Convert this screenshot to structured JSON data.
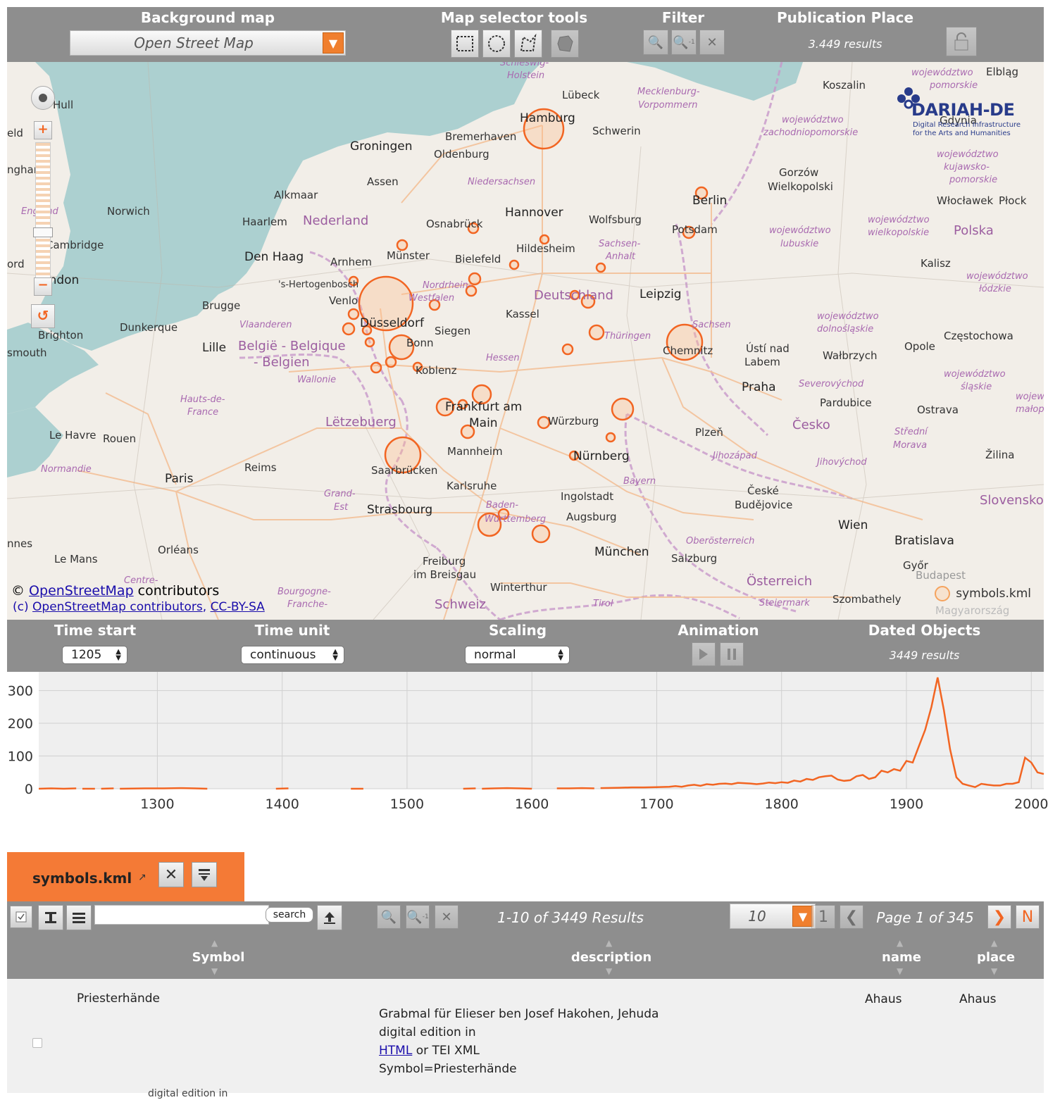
{
  "toolbar": {
    "background_map_title": "Background map",
    "background_map_value": "Open Street Map",
    "map_selector_title": "Map selector tools",
    "filter_title": "Filter",
    "publication_place_title": "Publication Place",
    "publication_place_results": "3.449 results",
    "icons": [
      "square-select-icon",
      "circle-select-icon",
      "polygon-select-icon",
      "country-select-icon",
      "zoom-in-icon",
      "zoom-inverse-icon",
      "clear-filter-icon",
      "lock-icon"
    ]
  },
  "map": {
    "attribution_prefix": "©",
    "attribution_link": "OpenStreetMap",
    "attribution_suffix": "contributors",
    "attribution2_prefix": "(c)",
    "attribution2_link1": "OpenStreetMap contributors",
    "attribution2_sep": ",",
    "attribution2_link2": "CC-BY-SA",
    "legend_label": "symbols.kml",
    "logo_title": "DARIAH-DE",
    "logo_sub1": "Digital Research Infrastructure",
    "logo_sub2": "for the Arts and Humanities",
    "marker_color": "#f26522",
    "labels": {
      "hamburg": "Hamburg",
      "lubeck": "Lübeck",
      "schwerin": "Schwerin",
      "bremerhaven": "Bremerhaven",
      "groningen": "Groningen",
      "oldenburg": "Oldenburg",
      "assen": "Assen",
      "alkmaar": "Alkmaar",
      "norwich": "Norwich",
      "haarlem": "Haarlem",
      "nederland": "Nederland",
      "osnabruck": "Osnabrück",
      "hannover": "Hannover",
      "wolfsburg": "Wolfsburg",
      "berlin": "Berlin",
      "potsdam": "Potsdam",
      "denhaag": "Den Haag",
      "arnhem": "Arnhem",
      "munster": "Münster",
      "bielefeld": "Bielefeld",
      "hildesheim": "Hildesheim",
      "london": "London",
      "cambridge": "Cambridge",
      "hull": "Hull",
      "hertogenbosch": "'s-Hertogenbosch",
      "venlo": "Venlo",
      "dusseldorf": "Düsseldorf",
      "kassel": "Kassel",
      "deutschland": "Deutschland",
      "leipzig": "Leipzig",
      "brugge": "Brugge",
      "dunkerque": "Dunkerque",
      "brighton": "Brighton",
      "lille": "Lille",
      "belgie": "België - Belgique",
      "belgien": "- Belgien",
      "bonn": "Bonn",
      "siegen": "Siegen",
      "koblenz": "Koblenz",
      "chemnitz": "Chemnitz",
      "usti": "Ústí nad",
      "labem": "Labem",
      "walbrzych": "Wałbrzych",
      "opole": "Opole",
      "praha": "Praha",
      "pardubice": "Pardubice",
      "frankfurt": "Frankfurt am",
      "main": "Main",
      "wurzburg": "Würzburg",
      "letzebuerg": "Lëtzebuerg",
      "plzen": "Plzeň",
      "cesko": "Česko",
      "ostrava": "Ostrava",
      "mannheim": "Mannheim",
      "nurnberg": "Nürnberg",
      "saarbrucken": "Saarbrücken",
      "reims": "Reims",
      "paris": "Paris",
      "lehavre": "Le Havre",
      "rouen": "Rouen",
      "karlsruhe": "Karlsruhe",
      "strasbourg": "Strasbourg",
      "stuttgart": "Württemberg",
      "ingolstadt": "Ingolstadt",
      "augsburg": "Augsburg",
      "ceske": "České",
      "budejovice": "Budějovice",
      "wien": "Wien",
      "bratislava": "Bratislava",
      "munchen": "München",
      "orleans": "Orléans",
      "lemans": "Le Mans",
      "freiburg": "Freiburg",
      "breisgau": "im Breisgau",
      "winterthur": "Winterthur",
      "salzburg": "Salzburg",
      "osterreich": "Österreich",
      "szombathely": "Szombathely",
      "gyor": "Győr",
      "budapest": "Budapest",
      "koszalin": "Koszalin",
      "elblag": "Elbląg",
      "gorzow": "Gorzów",
      "wielkopolski": "Wielkopolski",
      "wloclawek": "Włocławek",
      "plock": "Płock",
      "polska": "Polska",
      "kalisz": "Kalisz",
      "czestochowa": "Częstochowa",
      "zilina": "Žilina",
      "slovensko": "Slovensko",
      "schweiz": "Schweiz",
      "magyar": "Magyarország",
      "niedersachsen": "Niedersachsen",
      "nordrhein": "Nordrhein-",
      "westfalen": "Westfalen",
      "hessen": "Hessen",
      "thuringen": "Thüringen",
      "sachsen": "Sachsen",
      "sachsenanhalt": "Sachsen-",
      "anhalt": "Anhalt",
      "bayern": "Bayern",
      "baden": "Baden-",
      "mecklenburg": "Mecklenburg-",
      "vorpommern": "Vorpommern",
      "schleswig": "Schleswig-",
      "holstein": "Holstein",
      "vlaanderen": "Vlaanderen",
      "wallonie": "Wallonie",
      "hautsde": "Hauts-de-",
      "france": "France",
      "normandie": "Normandie",
      "grand": "Grand-",
      "est": "Est",
      "centre": "Centre-",
      "bourgogne": "Bourgogne-",
      "franche": "Franche-",
      "tirol": "Tirol",
      "steiermark": "Steiermark",
      "oberosterreich": "Oberösterreich",
      "jihozapad": "Jihozápad",
      "jihovychod": "Jihovýchod",
      "severovychod": "Severovýchod",
      "strednimorava": "Střední",
      "morava": "Morava",
      "zachodnio": "województwo",
      "zachodnio2": "zachodniopomorskie",
      "lubuskie1": "województwo",
      "lubuskie2": "lubuskie",
      "wielkopolskie1": "województwo",
      "wielkopolskie2": "wielkopolskie",
      "dolnoslaskie1": "województwo",
      "dolnoslaskie2": "dolnośląskie",
      "slaskie1": "województwo",
      "slaskie2": "śląskie",
      "lodzkie1": "województwo",
      "lodzkie2": "łódzkie",
      "kujawsko1": "województwo",
      "kujawsko2": "kujawsko-",
      "kujawsko3": "pomorskie",
      "pomorskie1": "województwo",
      "pomorskie2": "pomorskie",
      "england": "England",
      "southampton": "smouth",
      "nottingham": "ngham",
      "eld": "eld",
      "ord": "ord",
      "nnes": "nnes",
      "land": "land",
      "opsk": "opsk",
      "gdynia": "Gdynia",
      "lowermalopolskie": "małopo",
      "lower": "wojewó",
      "sw": "św",
      "wo": "wo"
    }
  },
  "timebar": {
    "time_start_title": "Time start",
    "time_start_value": "1205",
    "time_unit_title": "Time unit",
    "time_unit_value": "continuous",
    "scaling_title": "Scaling",
    "scaling_value": "normal",
    "animation_title": "Animation",
    "dated_objects_title": "Dated Objects",
    "dated_objects_results": "3449 results"
  },
  "chart_data": {
    "type": "line",
    "xlim": [
      1205,
      2010
    ],
    "ylim": [
      0,
      340
    ],
    "y_ticks": [
      0,
      100,
      200,
      300
    ],
    "x_ticks": [
      1300,
      1400,
      1500,
      1600,
      1700,
      1800,
      1900,
      2000
    ],
    "color": "#f26522",
    "grid": true,
    "series": [
      {
        "segments": [
          {
            "x": [
              1205,
              1215,
              1225,
              1235
            ],
            "y": [
              0,
              1,
              0,
              1
            ]
          },
          {
            "x": [
              1240,
              1250
            ],
            "y": [
              0,
              0
            ]
          },
          {
            "x": [
              1255,
              1265
            ],
            "y": [
              0,
              1
            ]
          },
          {
            "x": [
              1270,
              1290,
              1305,
              1320,
              1330,
              1340
            ],
            "y": [
              0,
              1,
              1,
              2,
              1,
              0
            ]
          },
          {
            "x": [
              1395,
              1405
            ],
            "y": [
              0,
              1
            ]
          },
          {
            "x": [
              1455,
              1465
            ],
            "y": [
              0,
              0
            ]
          },
          {
            "x": [
              1545,
              1555
            ],
            "y": [
              0,
              1
            ]
          },
          {
            "x": [
              1560,
              1570,
              1580,
              1590,
              1600
            ],
            "y": [
              0,
              1,
              2,
              1,
              0
            ]
          },
          {
            "x": [
              1620,
              1630,
              1640,
              1650
            ],
            "y": [
              1,
              1,
              2,
              1
            ]
          },
          {
            "x": [
              1655,
              1670,
              1680,
              1690,
              1700,
              1710,
              1715,
              1720,
              1725,
              1730,
              1735,
              1740,
              1745,
              1750,
              1755,
              1760,
              1765,
              1770,
              1775,
              1780,
              1785,
              1790,
              1795,
              1800,
              1805,
              1810,
              1815,
              1820,
              1825,
              1830,
              1835,
              1840,
              1845,
              1850,
              1855,
              1860,
              1865,
              1870,
              1875,
              1880,
              1885,
              1890,
              1895,
              1900,
              1905,
              1910,
              1915,
              1920,
              1925,
              1930,
              1935,
              1940,
              1945,
              1950,
              1955,
              1960,
              1965,
              1970,
              1975,
              1980,
              1985,
              1990,
              1995,
              2000,
              2005,
              2010
            ],
            "y": [
              2,
              3,
              4,
              4,
              5,
              6,
              8,
              6,
              10,
              12,
              9,
              14,
              12,
              15,
              16,
              14,
              18,
              17,
              16,
              14,
              16,
              19,
              17,
              20,
              18,
              25,
              22,
              30,
              27,
              35,
              38,
              40,
              28,
              24,
              26,
              38,
              42,
              30,
              35,
              55,
              50,
              60,
              55,
              85,
              80,
              130,
              180,
              250,
              340,
              240,
              120,
              35,
              15,
              10,
              5,
              15,
              12,
              10,
              10,
              15,
              15,
              20,
              95,
              80,
              50,
              45
            ]
          }
        ]
      }
    ]
  },
  "tab": {
    "label": "symbols.kml"
  },
  "table": {
    "search_button": "search",
    "search_value": "",
    "results_text": "1-10 of 3449 Results",
    "page_size": "10",
    "first_page": "1",
    "page_text": "Page 1 of 345",
    "last_page": "N",
    "headers": [
      "Symbol",
      "description",
      "name",
      "place"
    ],
    "rows": [
      {
        "symbol": "Priesterhände",
        "desc_line1": "Grabmal für Elieser ben Josef Hakohen, Jehuda",
        "desc_line2": "digital edition in",
        "desc_link": "HTML",
        "desc_line3_rest": "or TEI XML",
        "desc_line4": "Symbol=Priesterhände",
        "name": "Ahaus",
        "place": "Ahaus"
      }
    ],
    "next_row_partial": "digital edition in"
  }
}
